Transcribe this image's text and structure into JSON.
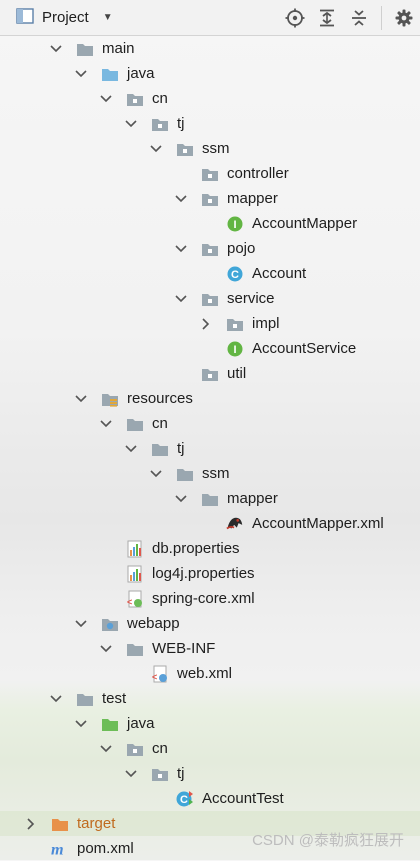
{
  "toolbar": {
    "title": "Project",
    "icons": [
      "locate-icon",
      "expand-all-icon",
      "collapse-all-icon",
      "settings-icon"
    ]
  },
  "tree": [
    {
      "label": "main",
      "depth": 0,
      "expanded": true,
      "icon": "folder"
    },
    {
      "label": "java",
      "depth": 1,
      "expanded": true,
      "icon": "source-folder"
    },
    {
      "label": "cn",
      "depth": 2,
      "expanded": true,
      "icon": "package"
    },
    {
      "label": "tj",
      "depth": 3,
      "expanded": true,
      "icon": "package"
    },
    {
      "label": "ssm",
      "depth": 4,
      "expanded": true,
      "icon": "package"
    },
    {
      "label": "controller",
      "depth": 5,
      "expanded": null,
      "icon": "package"
    },
    {
      "label": "mapper",
      "depth": 5,
      "expanded": true,
      "icon": "package"
    },
    {
      "label": "AccountMapper",
      "depth": 6,
      "expanded": null,
      "icon": "interface"
    },
    {
      "label": "pojo",
      "depth": 5,
      "expanded": true,
      "icon": "package"
    },
    {
      "label": "Account",
      "depth": 6,
      "expanded": null,
      "icon": "class"
    },
    {
      "label": "service",
      "depth": 5,
      "expanded": true,
      "icon": "package"
    },
    {
      "label": "impl",
      "depth": 6,
      "expanded": false,
      "icon": "package"
    },
    {
      "label": "AccountService",
      "depth": 6,
      "expanded": null,
      "icon": "interface"
    },
    {
      "label": "util",
      "depth": 5,
      "expanded": null,
      "icon": "package"
    },
    {
      "label": "resources",
      "depth": 1,
      "expanded": true,
      "icon": "resources-folder"
    },
    {
      "label": "cn",
      "depth": 2,
      "expanded": true,
      "icon": "folder"
    },
    {
      "label": "tj",
      "depth": 3,
      "expanded": true,
      "icon": "folder"
    },
    {
      "label": "ssm",
      "depth": 4,
      "expanded": true,
      "icon": "folder"
    },
    {
      "label": "mapper",
      "depth": 5,
      "expanded": true,
      "icon": "folder"
    },
    {
      "label": "AccountMapper.xml",
      "depth": 6,
      "expanded": null,
      "icon": "mybatis-xml"
    },
    {
      "label": "db.properties",
      "depth": 2,
      "expanded": null,
      "icon": "properties"
    },
    {
      "label": "log4j.properties",
      "depth": 2,
      "expanded": null,
      "icon": "properties"
    },
    {
      "label": "spring-core.xml",
      "depth": 2,
      "expanded": null,
      "icon": "spring-xml"
    },
    {
      "label": "webapp",
      "depth": 1,
      "expanded": true,
      "icon": "web-folder"
    },
    {
      "label": "WEB-INF",
      "depth": 2,
      "expanded": true,
      "icon": "folder"
    },
    {
      "label": "web.xml",
      "depth": 3,
      "expanded": null,
      "icon": "web-xml"
    },
    {
      "label": "test",
      "depth": 0,
      "expanded": true,
      "icon": "folder"
    },
    {
      "label": "java",
      "depth": 1,
      "expanded": true,
      "icon": "test-folder"
    },
    {
      "label": "cn",
      "depth": 2,
      "expanded": true,
      "icon": "package"
    },
    {
      "label": "tj",
      "depth": 3,
      "expanded": true,
      "icon": "package"
    },
    {
      "label": "AccountTest",
      "depth": 4,
      "expanded": null,
      "icon": "test-class"
    },
    {
      "label": "target",
      "depth": -1,
      "expanded": false,
      "icon": "excluded-folder",
      "selected": true,
      "orange": true
    },
    {
      "label": "pom.xml",
      "depth": -1,
      "expanded": null,
      "icon": "maven"
    }
  ],
  "watermark": "CSDN @泰勒疯狂展开",
  "colors": {
    "folder": "#9aa7b0",
    "source_folder": "#79b8e0",
    "test_folder": "#6dbd58",
    "excluded_folder": "#e8914a",
    "interface": "#62b543",
    "class": "#40a6d8",
    "selection": "#d7e4c8"
  }
}
